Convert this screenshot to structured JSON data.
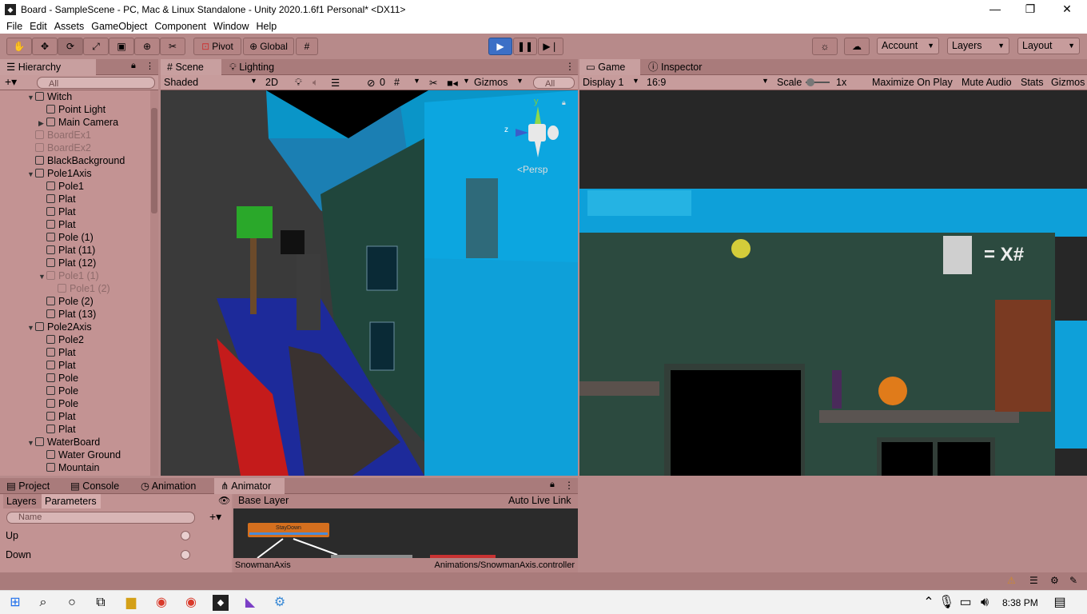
{
  "window": {
    "title": "Board - SampleScene - PC, Mac & Linux Standalone - Unity 2020.1.6f1 Personal* <DX11>",
    "minimize": "—",
    "maximize": "❐",
    "close": "✕"
  },
  "menu": [
    "File",
    "Edit",
    "Assets",
    "GameObject",
    "Component",
    "Window",
    "Help"
  ],
  "toolbar": {
    "pivot": "Pivot",
    "global": "Global",
    "account": "Account",
    "layers": "Layers",
    "layout": "Layout"
  },
  "hierarchy": {
    "tab": "Hierarchy",
    "search_placeholder": "All",
    "items": [
      {
        "label": "Witch",
        "indent": 1,
        "fold": "open",
        "dim": false
      },
      {
        "label": "Point Light",
        "indent": 2,
        "fold": "",
        "dim": false
      },
      {
        "label": "Main Camera",
        "indent": 2,
        "fold": "closed",
        "dim": false
      },
      {
        "label": "BoardEx1",
        "indent": 1,
        "fold": "",
        "dim": true
      },
      {
        "label": "BoardEx2",
        "indent": 1,
        "fold": "",
        "dim": true
      },
      {
        "label": "BlackBackground",
        "indent": 1,
        "fold": "",
        "dim": false
      },
      {
        "label": "Pole1Axis",
        "indent": 1,
        "fold": "open",
        "dim": false
      },
      {
        "label": "Pole1",
        "indent": 2,
        "fold": "",
        "dim": false
      },
      {
        "label": "Plat",
        "indent": 2,
        "fold": "",
        "dim": false
      },
      {
        "label": "Plat",
        "indent": 2,
        "fold": "",
        "dim": false
      },
      {
        "label": "Plat",
        "indent": 2,
        "fold": "",
        "dim": false
      },
      {
        "label": "Pole (1)",
        "indent": 2,
        "fold": "",
        "dim": false
      },
      {
        "label": "Plat (11)",
        "indent": 2,
        "fold": "",
        "dim": false
      },
      {
        "label": "Plat (12)",
        "indent": 2,
        "fold": "",
        "dim": false
      },
      {
        "label": "Pole1 (1)",
        "indent": 2,
        "fold": "open",
        "dim": true
      },
      {
        "label": "Pole1 (2)",
        "indent": 3,
        "fold": "",
        "dim": true
      },
      {
        "label": "Pole (2)",
        "indent": 2,
        "fold": "",
        "dim": false
      },
      {
        "label": "Plat (13)",
        "indent": 2,
        "fold": "",
        "dim": false
      },
      {
        "label": "Pole2Axis",
        "indent": 1,
        "fold": "open",
        "dim": false
      },
      {
        "label": "Pole2",
        "indent": 2,
        "fold": "",
        "dim": false
      },
      {
        "label": "Plat",
        "indent": 2,
        "fold": "",
        "dim": false
      },
      {
        "label": "Plat",
        "indent": 2,
        "fold": "",
        "dim": false
      },
      {
        "label": "Pole",
        "indent": 2,
        "fold": "",
        "dim": false
      },
      {
        "label": "Pole",
        "indent": 2,
        "fold": "",
        "dim": false
      },
      {
        "label": "Pole",
        "indent": 2,
        "fold": "",
        "dim": false
      },
      {
        "label": "Plat",
        "indent": 2,
        "fold": "",
        "dim": false
      },
      {
        "label": "Plat",
        "indent": 2,
        "fold": "",
        "dim": false
      },
      {
        "label": "WaterBoard",
        "indent": 1,
        "fold": "open",
        "dim": false
      },
      {
        "label": "Water Ground",
        "indent": 2,
        "fold": "",
        "dim": false
      },
      {
        "label": "Mountain",
        "indent": 2,
        "fold": "",
        "dim": false
      }
    ]
  },
  "scene": {
    "tabs": [
      "Scene",
      "Lighting"
    ],
    "shading": "Shaded",
    "mode2d": "2D",
    "fx_count": "0",
    "gizmos": "Gizmos",
    "search_placeholder": "All",
    "persp": "Persp",
    "axis_y": "y",
    "axis_z": "z"
  },
  "game": {
    "tabs": [
      "Game",
      "Inspector"
    ],
    "display": "Display 1",
    "aspect": "16:9",
    "scale_label": "Scale",
    "scale_value": "1x",
    "maximize": "Maximize On Play",
    "mute": "Mute Audio",
    "stats": "Stats",
    "gizmos": "Gizmos",
    "hud_text": "= X#"
  },
  "bottom": {
    "tabs": [
      "Project",
      "Console",
      "Animation",
      "Animator"
    ],
    "sub_tabs": [
      "Layers",
      "Parameters"
    ],
    "search_placeholder": "Name",
    "params": [
      "Up",
      "Down"
    ],
    "base_layer": "Base Layer",
    "auto_live": "Auto Live Link",
    "state": "StayDown",
    "footer_left": "SnowmanAxis",
    "footer_right": "Animations/SnowmanAxis.controller"
  },
  "taskbar": {
    "time": "8:38 PM"
  }
}
